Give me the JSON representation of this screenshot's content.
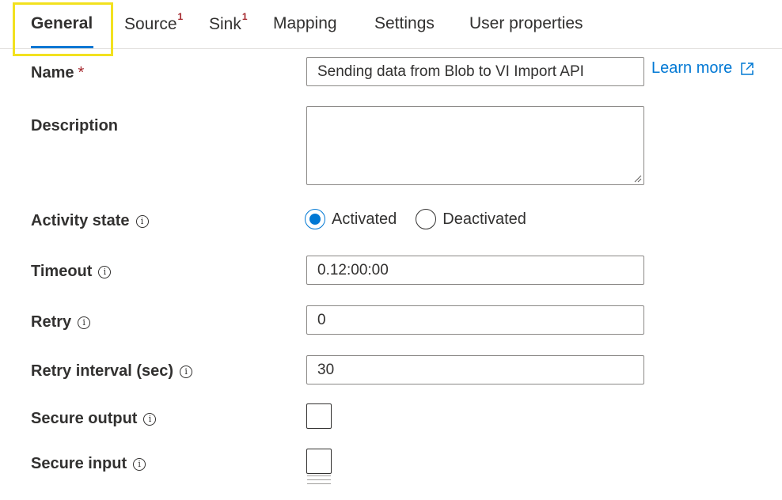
{
  "tabs": [
    {
      "label": "General",
      "badge": ""
    },
    {
      "label": "Source",
      "badge": "1"
    },
    {
      "label": "Sink",
      "badge": "1"
    },
    {
      "label": "Mapping",
      "badge": ""
    },
    {
      "label": "Settings",
      "badge": ""
    },
    {
      "label": "User properties",
      "badge": ""
    }
  ],
  "active_tab": "General",
  "form": {
    "name": {
      "label": "Name",
      "required_mark": "*",
      "value": "Sending data from Blob to VI Import API"
    },
    "learn_more": "Learn more",
    "description": {
      "label": "Description",
      "value": ""
    },
    "activity_state": {
      "label": "Activity state",
      "options": [
        "Activated",
        "Deactivated"
      ],
      "selected": "Activated"
    },
    "timeout": {
      "label": "Timeout",
      "value": "0.12:00:00"
    },
    "retry": {
      "label": "Retry",
      "value": "0"
    },
    "retry_interval": {
      "label": "Retry interval (sec)",
      "value": "30"
    },
    "secure_output": {
      "label": "Secure output",
      "checked": false
    },
    "secure_input": {
      "label": "Secure input",
      "checked": false
    }
  },
  "colors": {
    "accent": "#0078d4",
    "required": "#a4262c",
    "highlight": "#f2e11f"
  },
  "icons": {
    "info": "info-icon",
    "external_link": "external-link-icon"
  }
}
